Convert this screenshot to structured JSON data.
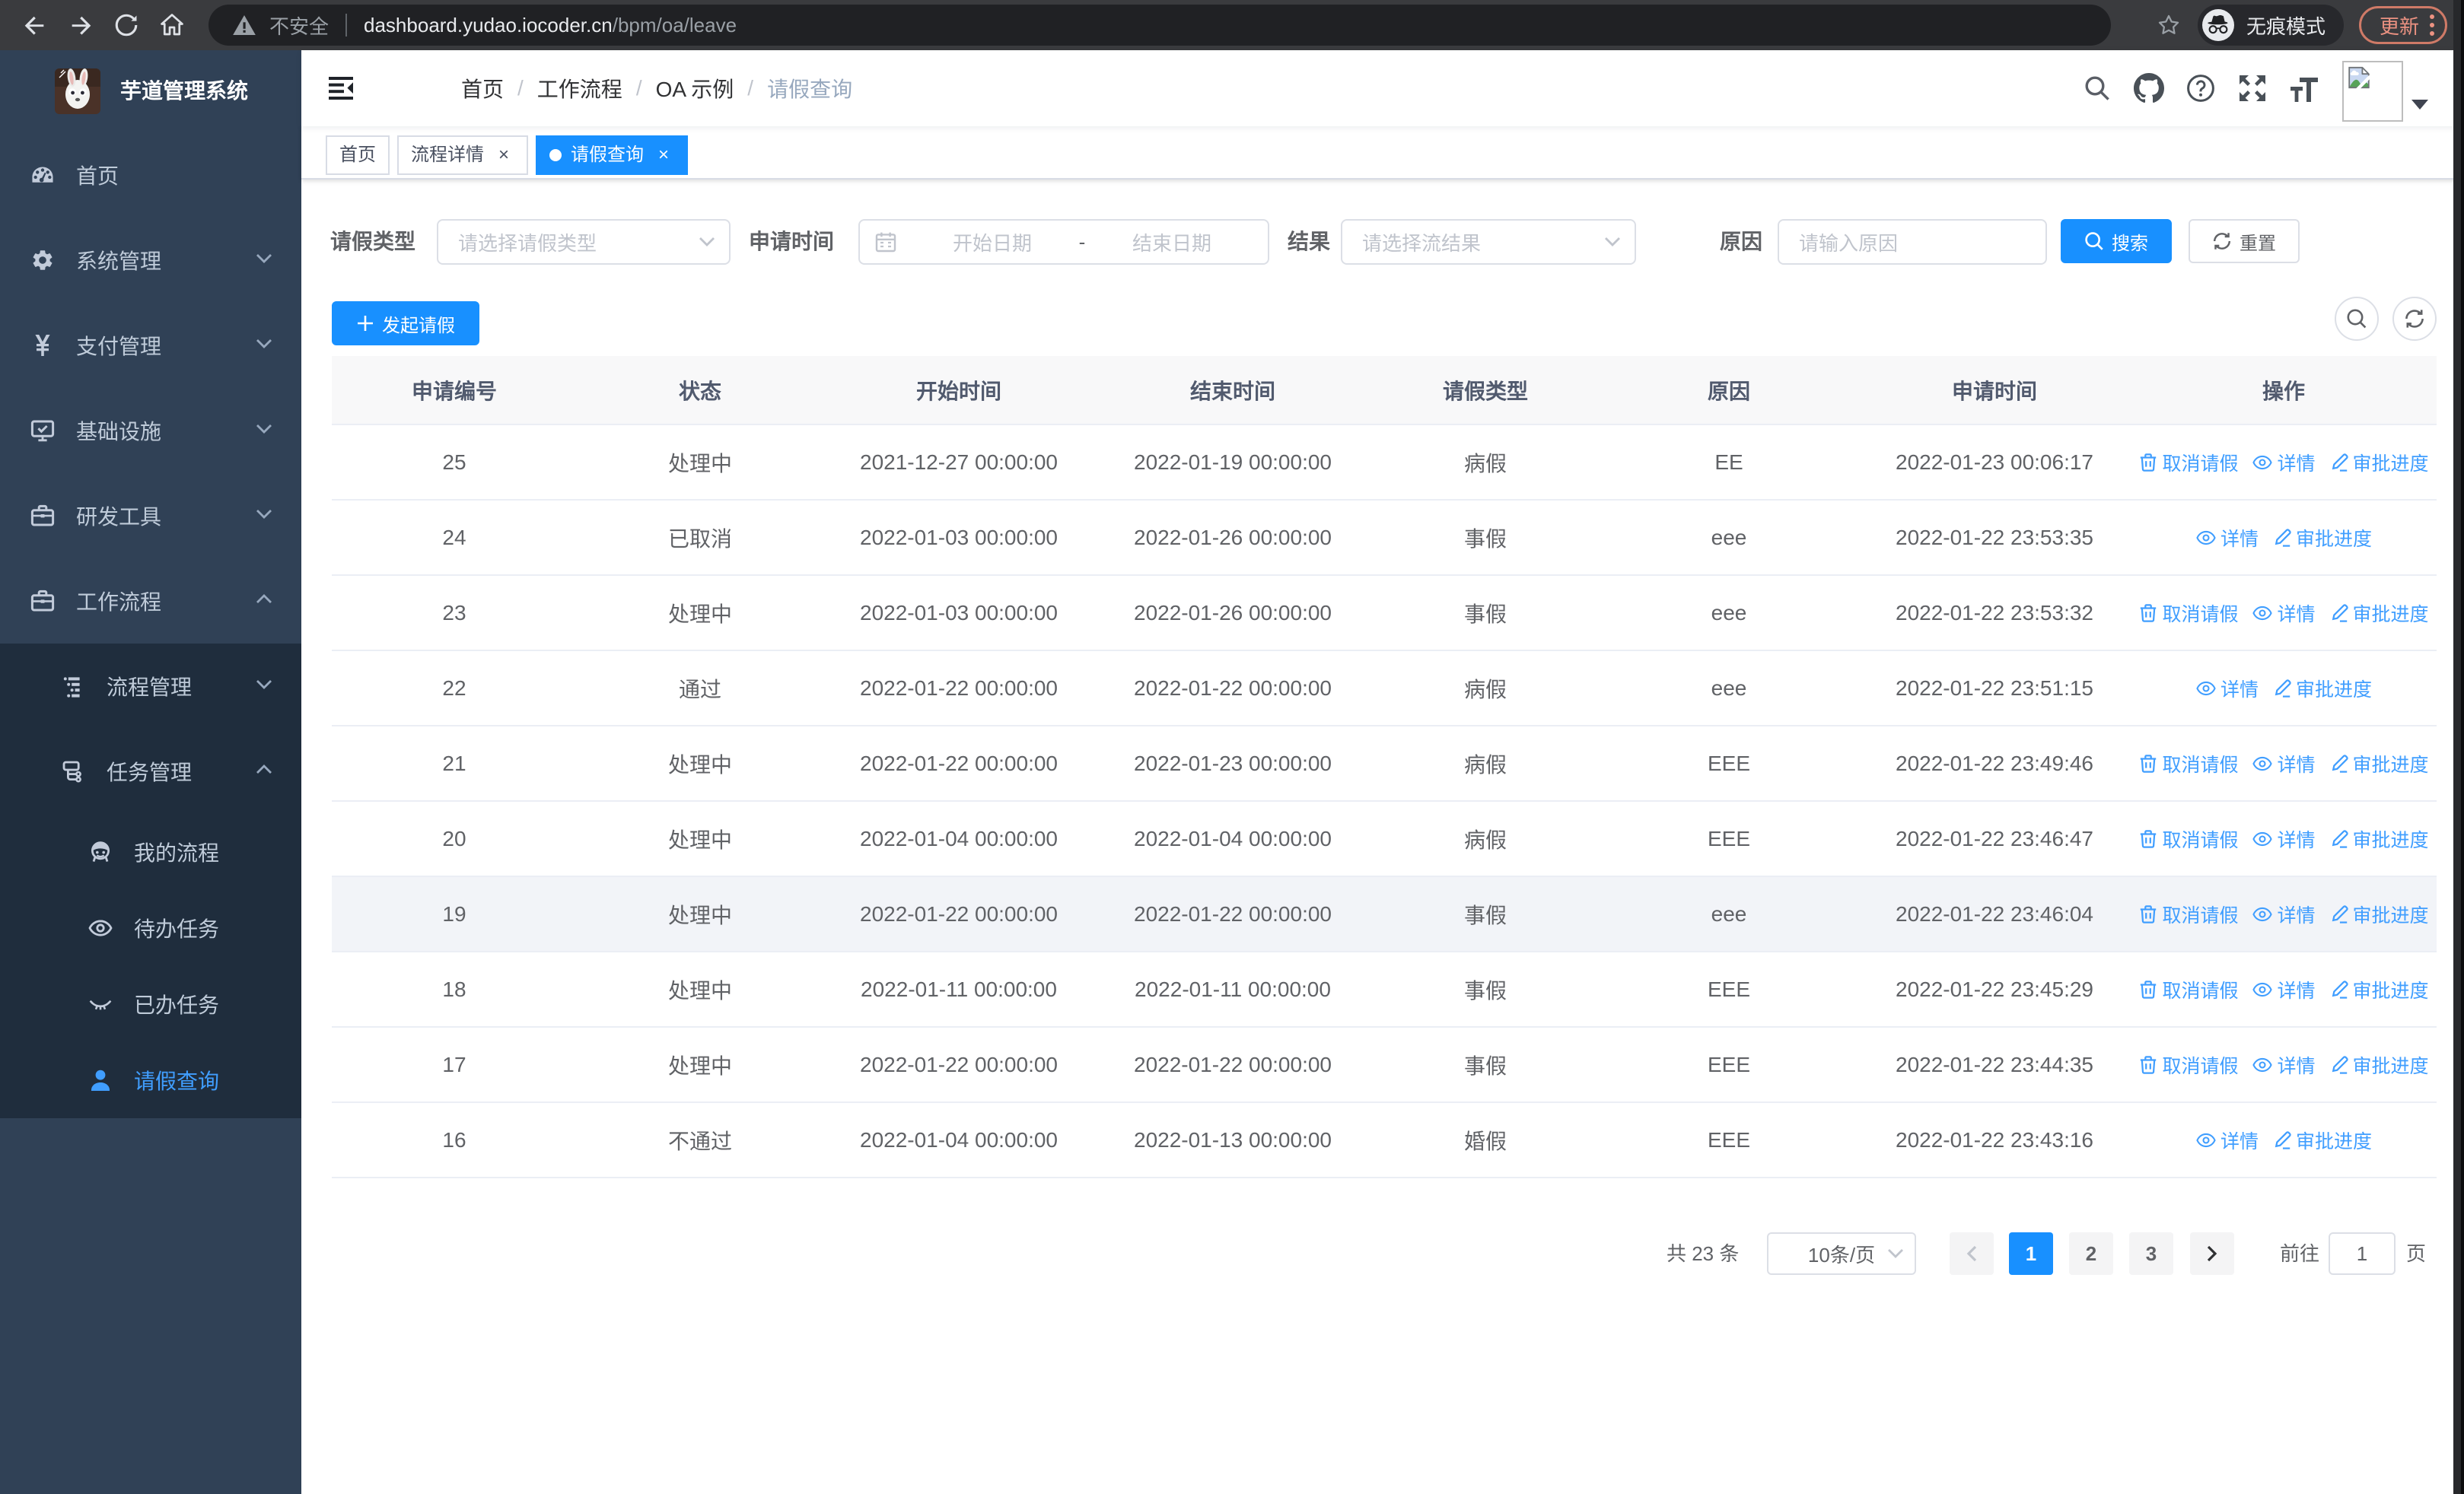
{
  "browser": {
    "security_label": "不安全",
    "url_host": "dashboard.yudao.iocoder.cn",
    "url_path": "/bpm/oa/leave",
    "incognito_label": "无痕模式",
    "update_label": "更新"
  },
  "sidebar": {
    "title": "芋道管理系统",
    "menu": [
      {
        "label": "首页",
        "icon": "dashboard-icon",
        "arrow": ""
      },
      {
        "label": "系统管理",
        "icon": "gear-icon",
        "arrow": "down"
      },
      {
        "label": "支付管理",
        "icon": "yen-icon",
        "arrow": "down"
      },
      {
        "label": "基础设施",
        "icon": "monitor-icon",
        "arrow": "down"
      },
      {
        "label": "研发工具",
        "icon": "toolbox-icon",
        "arrow": "down"
      },
      {
        "label": "工作流程",
        "icon": "briefcase-icon",
        "arrow": "up"
      }
    ],
    "submenu": [
      {
        "label": "流程管理",
        "icon": "tree-icon",
        "arrow": "down"
      },
      {
        "label": "任务管理",
        "icon": "flow-icon",
        "arrow": "up"
      }
    ],
    "tasks": [
      {
        "label": "我的流程",
        "icon": "people-icon",
        "active": false
      },
      {
        "label": "待办任务",
        "icon": "eye-open-icon",
        "active": false
      },
      {
        "label": "已办任务",
        "icon": "eye-closed-icon",
        "active": false
      },
      {
        "label": "请假查询",
        "icon": "user-icon",
        "active": true
      }
    ]
  },
  "navbar": {
    "breadcrumb": [
      "首页",
      "工作流程",
      "OA 示例",
      "请假查询"
    ]
  },
  "tabs": [
    {
      "label": "首页",
      "closable": false,
      "active": false
    },
    {
      "label": "流程详情",
      "closable": true,
      "active": false
    },
    {
      "label": "请假查询",
      "closable": true,
      "active": true
    }
  ],
  "filters": {
    "leave_type_label": "请假类型",
    "leave_type_placeholder": "请选择请假类型",
    "apply_time_label": "申请时间",
    "date_start_placeholder": "开始日期",
    "date_separator": "-",
    "date_end_placeholder": "结束日期",
    "result_label": "结果",
    "result_placeholder": "请选择流结果",
    "reason_label": "原因",
    "reason_placeholder": "请输入原因",
    "search_label": "搜索",
    "reset_label": "重置"
  },
  "toolbar": {
    "create_label": "发起请假"
  },
  "table": {
    "columns": [
      "申请编号",
      "状态",
      "开始时间",
      "结束时间",
      "请假类型",
      "原因",
      "申请时间",
      "操作"
    ],
    "action_labels": {
      "cancel": "取消请假",
      "detail": "详情",
      "progress": "审批进度"
    },
    "rows": [
      {
        "id": "25",
        "status": "处理中",
        "start": "2021-12-27 00:00:00",
        "end": "2022-01-19 00:00:00",
        "type": "病假",
        "reason": "EE",
        "apply_time": "2022-01-23 00:06:17",
        "actions": [
          "cancel",
          "detail",
          "progress"
        ],
        "highlighted": false
      },
      {
        "id": "24",
        "status": "已取消",
        "start": "2022-01-03 00:00:00",
        "end": "2022-01-26 00:00:00",
        "type": "事假",
        "reason": "eee",
        "apply_time": "2022-01-22 23:53:35",
        "actions": [
          "detail",
          "progress"
        ],
        "highlighted": false
      },
      {
        "id": "23",
        "status": "处理中",
        "start": "2022-01-03 00:00:00",
        "end": "2022-01-26 00:00:00",
        "type": "事假",
        "reason": "eee",
        "apply_time": "2022-01-22 23:53:32",
        "actions": [
          "cancel",
          "detail",
          "progress"
        ],
        "highlighted": false
      },
      {
        "id": "22",
        "status": "通过",
        "start": "2022-01-22 00:00:00",
        "end": "2022-01-22 00:00:00",
        "type": "病假",
        "reason": "eee",
        "apply_time": "2022-01-22 23:51:15",
        "actions": [
          "detail",
          "progress"
        ],
        "highlighted": false
      },
      {
        "id": "21",
        "status": "处理中",
        "start": "2022-01-22 00:00:00",
        "end": "2022-01-23 00:00:00",
        "type": "病假",
        "reason": "EEE",
        "apply_time": "2022-01-22 23:49:46",
        "actions": [
          "cancel",
          "detail",
          "progress"
        ],
        "highlighted": false
      },
      {
        "id": "20",
        "status": "处理中",
        "start": "2022-01-04 00:00:00",
        "end": "2022-01-04 00:00:00",
        "type": "病假",
        "reason": "EEE",
        "apply_time": "2022-01-22 23:46:47",
        "actions": [
          "cancel",
          "detail",
          "progress"
        ],
        "highlighted": false
      },
      {
        "id": "19",
        "status": "处理中",
        "start": "2022-01-22 00:00:00",
        "end": "2022-01-22 00:00:00",
        "type": "事假",
        "reason": "eee",
        "apply_time": "2022-01-22 23:46:04",
        "actions": [
          "cancel",
          "detail",
          "progress"
        ],
        "highlighted": true
      },
      {
        "id": "18",
        "status": "处理中",
        "start": "2022-01-11 00:00:00",
        "end": "2022-01-11 00:00:00",
        "type": "事假",
        "reason": "EEE",
        "apply_time": "2022-01-22 23:45:29",
        "actions": [
          "cancel",
          "detail",
          "progress"
        ],
        "highlighted": false
      },
      {
        "id": "17",
        "status": "处理中",
        "start": "2022-01-22 00:00:00",
        "end": "2022-01-22 00:00:00",
        "type": "事假",
        "reason": "EEE",
        "apply_time": "2022-01-22 23:44:35",
        "actions": [
          "cancel",
          "detail",
          "progress"
        ],
        "highlighted": false
      },
      {
        "id": "16",
        "status": "不通过",
        "start": "2022-01-04 00:00:00",
        "end": "2022-01-13 00:00:00",
        "type": "婚假",
        "reason": "EEE",
        "apply_time": "2022-01-22 23:43:16",
        "actions": [
          "detail",
          "progress"
        ],
        "highlighted": false
      }
    ]
  },
  "pagination": {
    "total_label": "共 23 条",
    "page_size_label": "10条/页",
    "pages": [
      "1",
      "2",
      "3"
    ],
    "active_page": "1",
    "goto_label": "前往",
    "goto_value": "1",
    "page_suffix_label": "页"
  },
  "colors": {
    "primary": "#1890ff",
    "sidebar_bg": "#304156",
    "submenu_bg": "#1f2d3d",
    "sidebar_active": "#409eff",
    "tab_active_bg": "#1890ff"
  }
}
